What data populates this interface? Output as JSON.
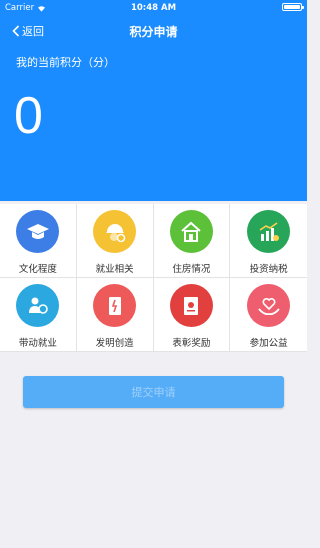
{
  "status_bar": {
    "carrier": "Carrier",
    "time": "10:48 AM"
  },
  "nav": {
    "back_label": "返回",
    "title": "积分申请"
  },
  "points": {
    "label": "我的当前积分（分）",
    "value": "0"
  },
  "categories": [
    {
      "label": "文化程度",
      "icon": "graduation-cap-icon",
      "color": "#3d7ee6"
    },
    {
      "label": "就业相关",
      "icon": "worker-helmet-icon",
      "color": "#f5c234"
    },
    {
      "label": "住房情况",
      "icon": "house-icon",
      "color": "#5cc039"
    },
    {
      "label": "投资纳税",
      "icon": "investment-chart-icon",
      "color": "#27a65a"
    },
    {
      "label": "带动就业",
      "icon": "people-handshake-icon",
      "color": "#2ba8e0"
    },
    {
      "label": "发明创造",
      "icon": "invention-document-icon",
      "color": "#ee5a5a"
    },
    {
      "label": "表彰奖励",
      "icon": "certificate-icon",
      "color": "#e2403f"
    },
    {
      "label": "参加公益",
      "icon": "heart-hands-icon",
      "color": "#ee5e6e"
    }
  ],
  "submit": {
    "label": "提交申请"
  },
  "colors": {
    "header": "#1a8cff",
    "button": "#56adf7",
    "background": "#efeff4"
  }
}
